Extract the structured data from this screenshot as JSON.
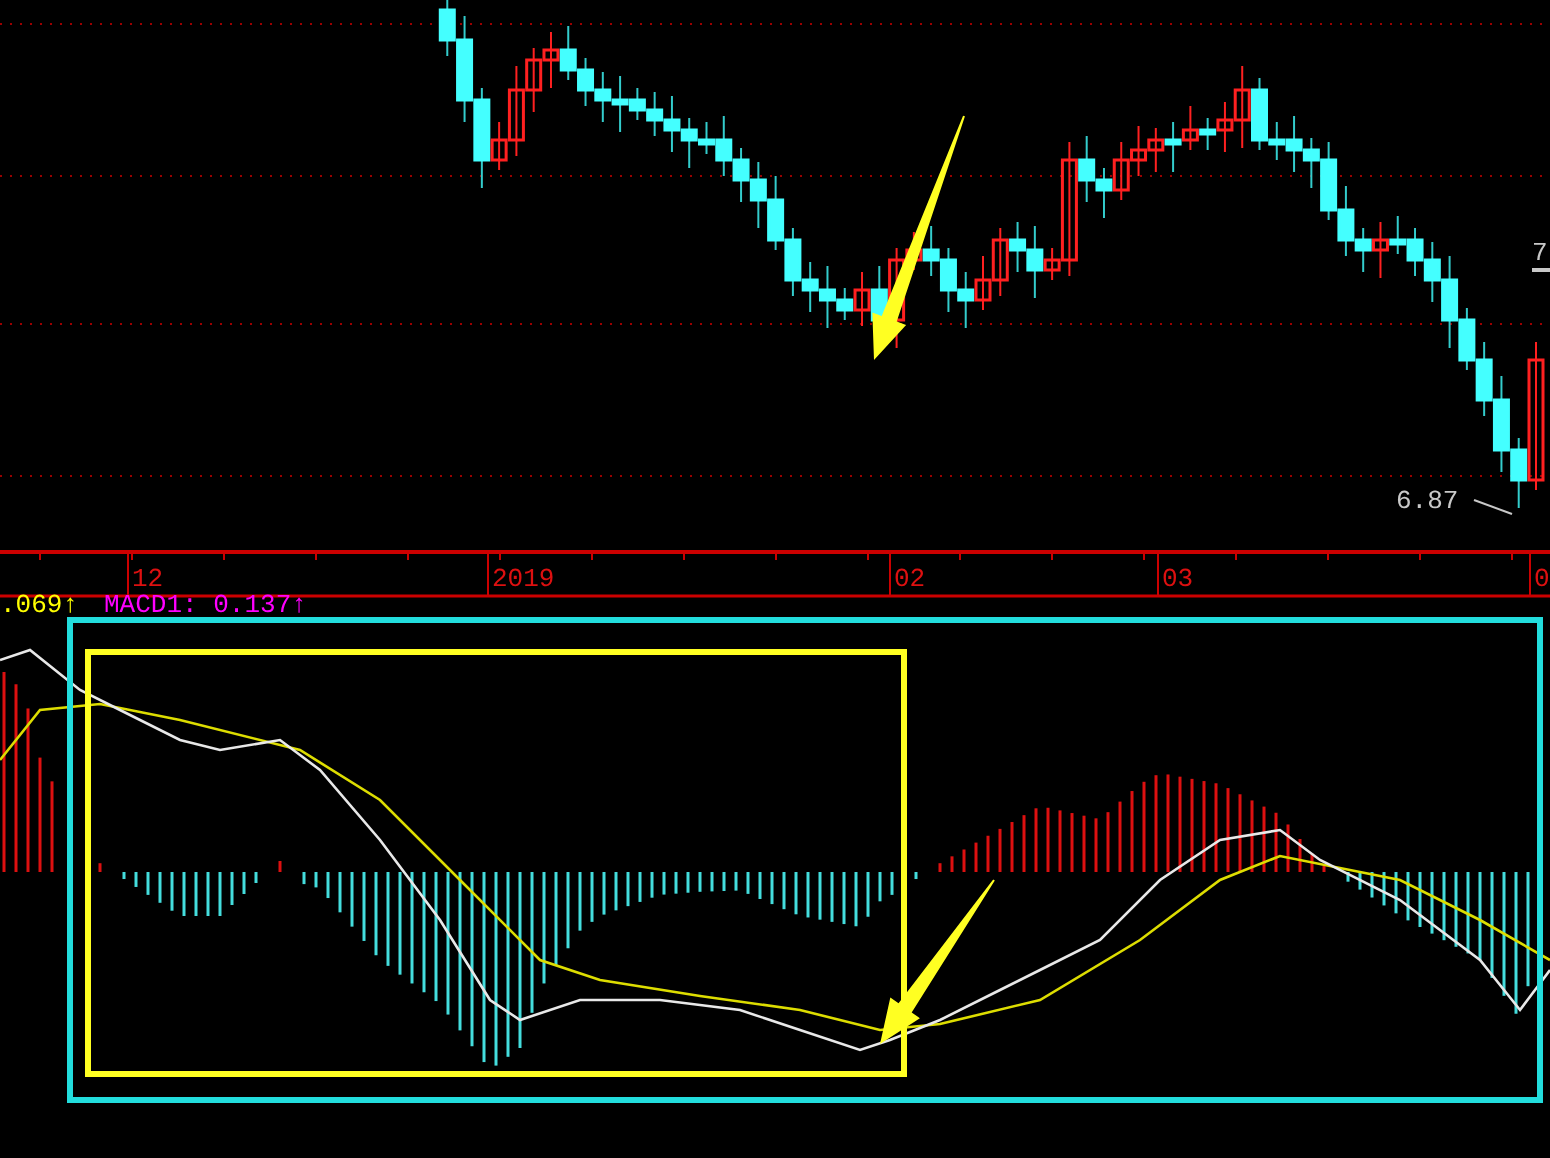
{
  "price_chart": {
    "labels": [
      {
        "kind": "edge",
        "text": "7"
      },
      {
        "kind": "low",
        "text": "6.87"
      }
    ]
  },
  "time_axis": {
    "labels": [
      "12",
      "2019",
      "02",
      "03",
      "0"
    ]
  },
  "macd": {
    "legend": [
      {
        "text": ".069↑",
        "color": "#ffff00"
      },
      {
        "text": "MACD1: 0.137↑",
        "color": "#ff00ff"
      }
    ]
  },
  "annotations": [
    {
      "kind": "box",
      "color": "#22dddd"
    },
    {
      "kind": "box",
      "color": "#ffff22"
    },
    {
      "kind": "arrow",
      "color": "#ffff22"
    },
    {
      "kind": "arrow",
      "color": "#ffff22"
    }
  ]
}
